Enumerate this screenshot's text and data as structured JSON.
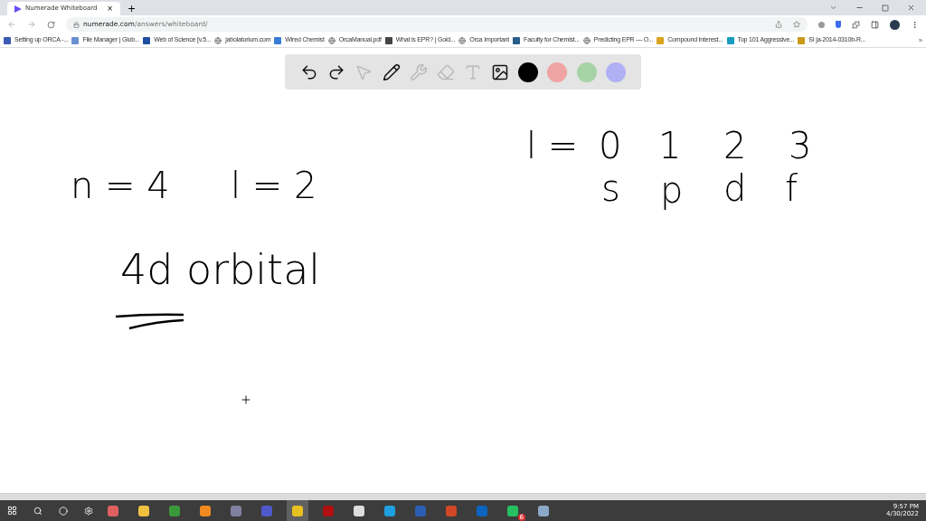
{
  "tab": {
    "title": "Numerade Whiteboard",
    "close": "×",
    "new_tab": "+"
  },
  "address": {
    "domain": "numerade.com",
    "path": "/answers/whiteboard/"
  },
  "bookmarks": [
    {
      "label": "Setting up ORCA -...",
      "kind": "favicon",
      "color": "#3b5bb5"
    },
    {
      "label": "File Manager | Glob...",
      "kind": "favicon",
      "color": "#6a8fd0"
    },
    {
      "label": "Web of Science [v.5...",
      "kind": "favicon",
      "color": "#1f4fa0"
    },
    {
      "label": "jabolatorium.com",
      "kind": "globe"
    },
    {
      "label": "Wired Chemist",
      "kind": "favicon",
      "color": "#3a7bd5"
    },
    {
      "label": "OrcaManual.pdf",
      "kind": "globe"
    },
    {
      "label": "What is EPR? | Gold...",
      "kind": "favicon",
      "color": "#444444"
    },
    {
      "label": "Orca Important",
      "kind": "globe"
    },
    {
      "label": "Faculty for Chemist...",
      "kind": "favicon",
      "color": "#2a5d8a"
    },
    {
      "label": "Predicting EPR — O...",
      "kind": "globe"
    },
    {
      "label": "Compound Interest...",
      "kind": "favicon",
      "color": "#d9a520"
    },
    {
      "label": "Top 101 Aggressive...",
      "kind": "favicon",
      "color": "#1a9bc0"
    },
    {
      "label": "SI ja-2014-0310b-R...",
      "kind": "favicon",
      "color": "#c99a1a"
    }
  ],
  "bookmarks_more": "»",
  "tools": [
    {
      "kind": "undo",
      "disabled": false
    },
    {
      "kind": "redo",
      "disabled": false
    },
    {
      "kind": "select",
      "disabled": true
    },
    {
      "kind": "pen",
      "disabled": false
    },
    {
      "kind": "tools",
      "disabled": true
    },
    {
      "kind": "eraser",
      "disabled": true
    },
    {
      "kind": "text",
      "disabled": true
    },
    {
      "kind": "image",
      "disabled": false
    }
  ],
  "colors": [
    {
      "color": "#000000"
    },
    {
      "color": "#f0a3a3"
    },
    {
      "color": "#a6d3a6"
    },
    {
      "color": "#b0b0f5"
    }
  ],
  "whiteboard": [
    {
      "text": "n = 4"
    },
    {
      "text": "l = 2"
    },
    {
      "text": "4d orbital"
    },
    {
      "text": "l ="
    },
    {
      "text": "0"
    },
    {
      "text": "1"
    },
    {
      "text": "2"
    },
    {
      "text": "3"
    },
    {
      "text": "s"
    },
    {
      "text": "p"
    },
    {
      "text": "d"
    },
    {
      "text": "f"
    }
  ],
  "taskbar": [
    {
      "color": "#e06060",
      "selected": false
    },
    {
      "color": "#f0c040",
      "selected": false
    },
    {
      "color": "#3a9a3a",
      "selected": false
    },
    {
      "color": "#f08a20",
      "selected": false
    },
    {
      "color": "#8080a0",
      "selected": false
    },
    {
      "color": "#5059c9",
      "selected": false
    },
    {
      "color": "#e8c020",
      "selected": true
    },
    {
      "color": "#b01010",
      "selected": false
    },
    {
      "color": "#dddddd",
      "selected": false
    },
    {
      "color": "#1ea0e0",
      "selected": false
    },
    {
      "color": "#2b5fb5",
      "selected": false
    },
    {
      "color": "#d24726",
      "selected": false
    },
    {
      "color": "#0a64c0",
      "selected": false
    },
    {
      "color": "#25c060",
      "selected": false
    },
    {
      "color": "#8aa8c8",
      "selected": false
    }
  ],
  "whatsapp_badge": "6",
  "clock": {
    "time": "9:57 PM",
    "date": "4/30/2022"
  }
}
